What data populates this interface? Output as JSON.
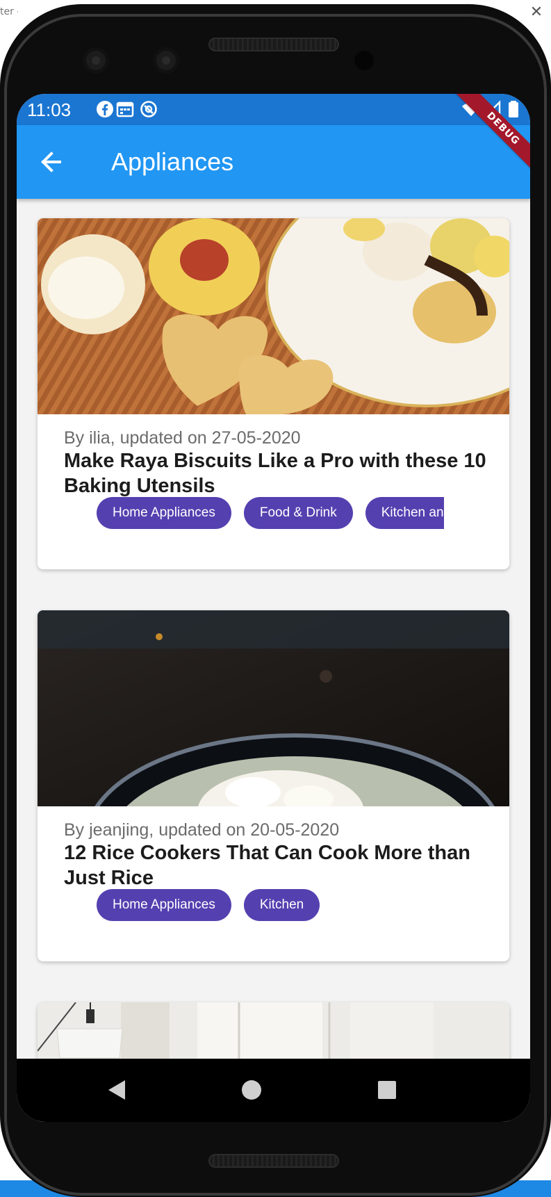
{
  "window": {
    "title_fragment": "ter - ",
    "close_glyph": "✕"
  },
  "status_bar": {
    "time": "11:03"
  },
  "app_bar": {
    "title": "Appliances",
    "debug_label": "DEBUG"
  },
  "articles": [
    {
      "meta": "By ilia, updated on 27-05-2020",
      "title": "Make Raya Biscuits Like a Pro with these 10 Baking Utensils",
      "tags": [
        "Home Appliances",
        "Food & Drink",
        "Kitchen and"
      ],
      "image": "biscuits-photo"
    },
    {
      "meta": "By jeanjing, updated on 20-05-2020",
      "title": "12 Rice Cookers That Can Cook More than Just Rice",
      "tags": [
        "Home Appliances",
        "Kitchen"
      ],
      "image": "rice-bowl-photo"
    },
    {
      "image": "interior-photo"
    }
  ],
  "colors": {
    "status_bar": "#1b76d2",
    "app_bar": "#2196f3",
    "tag": "#5540b0",
    "debug_banner": "#a3182a"
  }
}
